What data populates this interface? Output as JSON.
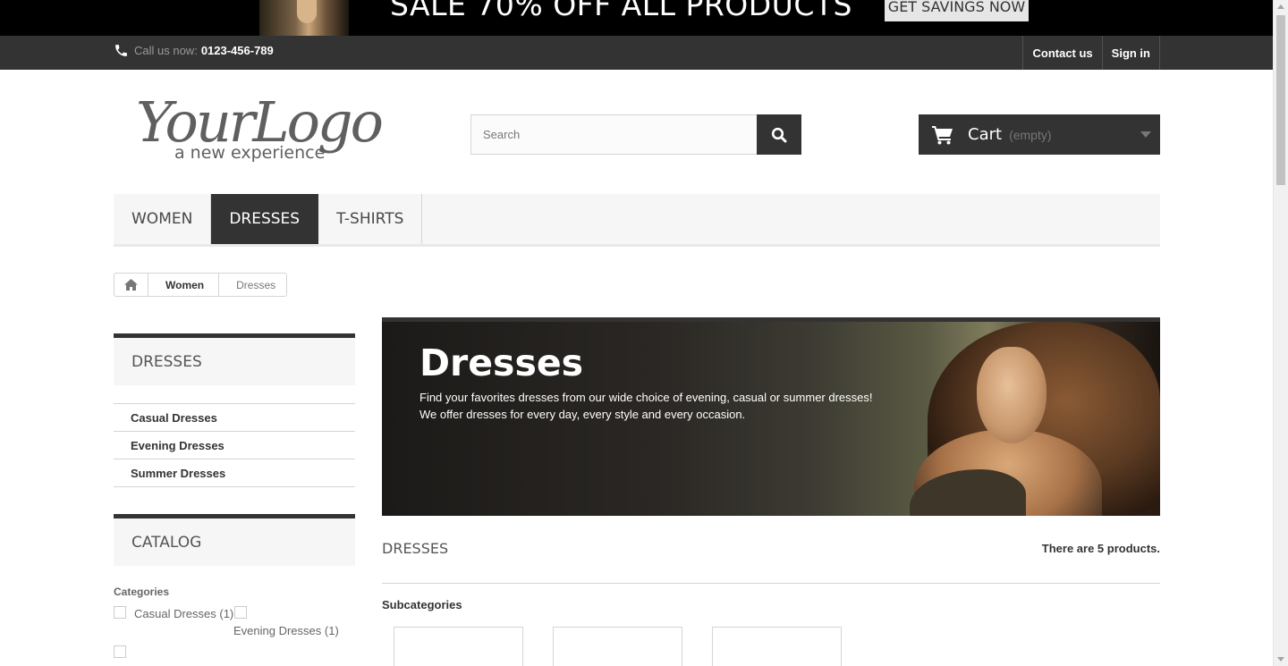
{
  "promo": {
    "text": "SALE 70% OFF ALL PRODUCTS",
    "button_label": "GET SAVINGS NOW"
  },
  "topbar": {
    "call_label": "Call us now:",
    "phone": "0123-456-789",
    "links": [
      "Contact us",
      "Sign in"
    ]
  },
  "header": {
    "logo_main": "YourLogo",
    "logo_tagline": "a new experience",
    "search_placeholder": "Search",
    "cart_label": "Cart",
    "cart_status": "(empty)"
  },
  "menu": {
    "items": [
      "WOMEN",
      "DRESSES",
      "T-SHIRTS"
    ],
    "active": "DRESSES"
  },
  "breadcrumb": {
    "items": [
      "Women",
      "Dresses"
    ]
  },
  "sidebar": {
    "category_title": "DRESSES",
    "categories": [
      "Casual Dresses",
      "Evening Dresses",
      "Summer Dresses"
    ],
    "catalog_title": "CATALOG",
    "filter_label": "Categories",
    "filters": [
      "Casual Dresses (1)",
      "Evening Dresses (1)"
    ]
  },
  "main": {
    "banner_title": "Dresses",
    "banner_desc_line1": "Find your favorites dresses from our wide choice of evening, casual or summer dresses!",
    "banner_desc_line2": "We offer dresses for every day, every style and every occasion.",
    "heading": "DRESSES",
    "product_count": "There are 5 products.",
    "subcategories_title": "Subcategories"
  },
  "colors": {
    "dark": "#333333",
    "light_bg": "#f6f6f6",
    "border": "#d6d4d4"
  }
}
